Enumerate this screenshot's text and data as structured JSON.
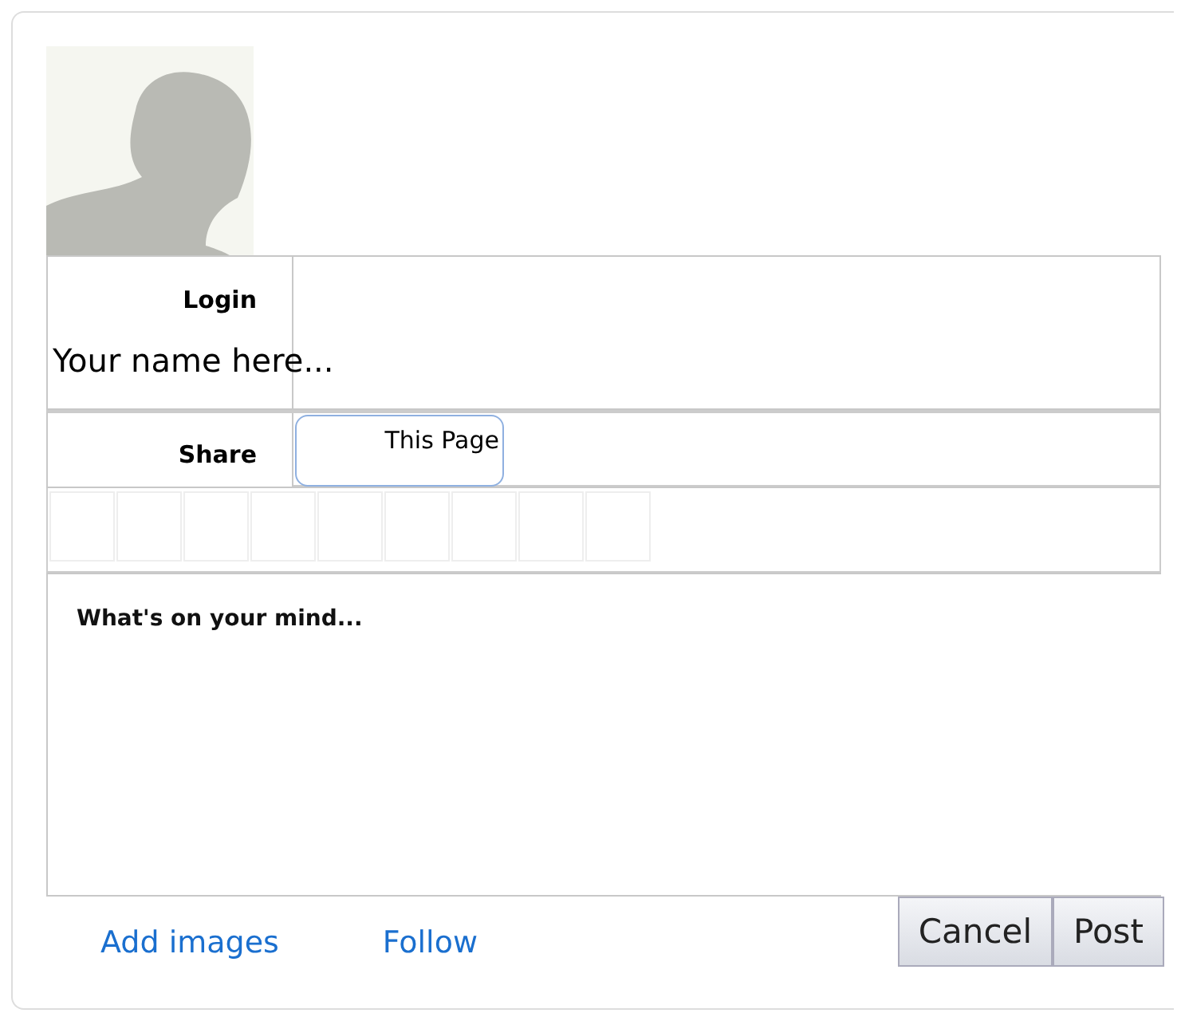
{
  "login": {
    "label": "Login",
    "placeholder": "Your name here..."
  },
  "share": {
    "label": "Share",
    "option": "This Page"
  },
  "message": {
    "placeholder": "What's on your mind..."
  },
  "links": [
    "Add images",
    "Follow"
  ],
  "buttons": [
    "Cancel",
    "Post"
  ]
}
